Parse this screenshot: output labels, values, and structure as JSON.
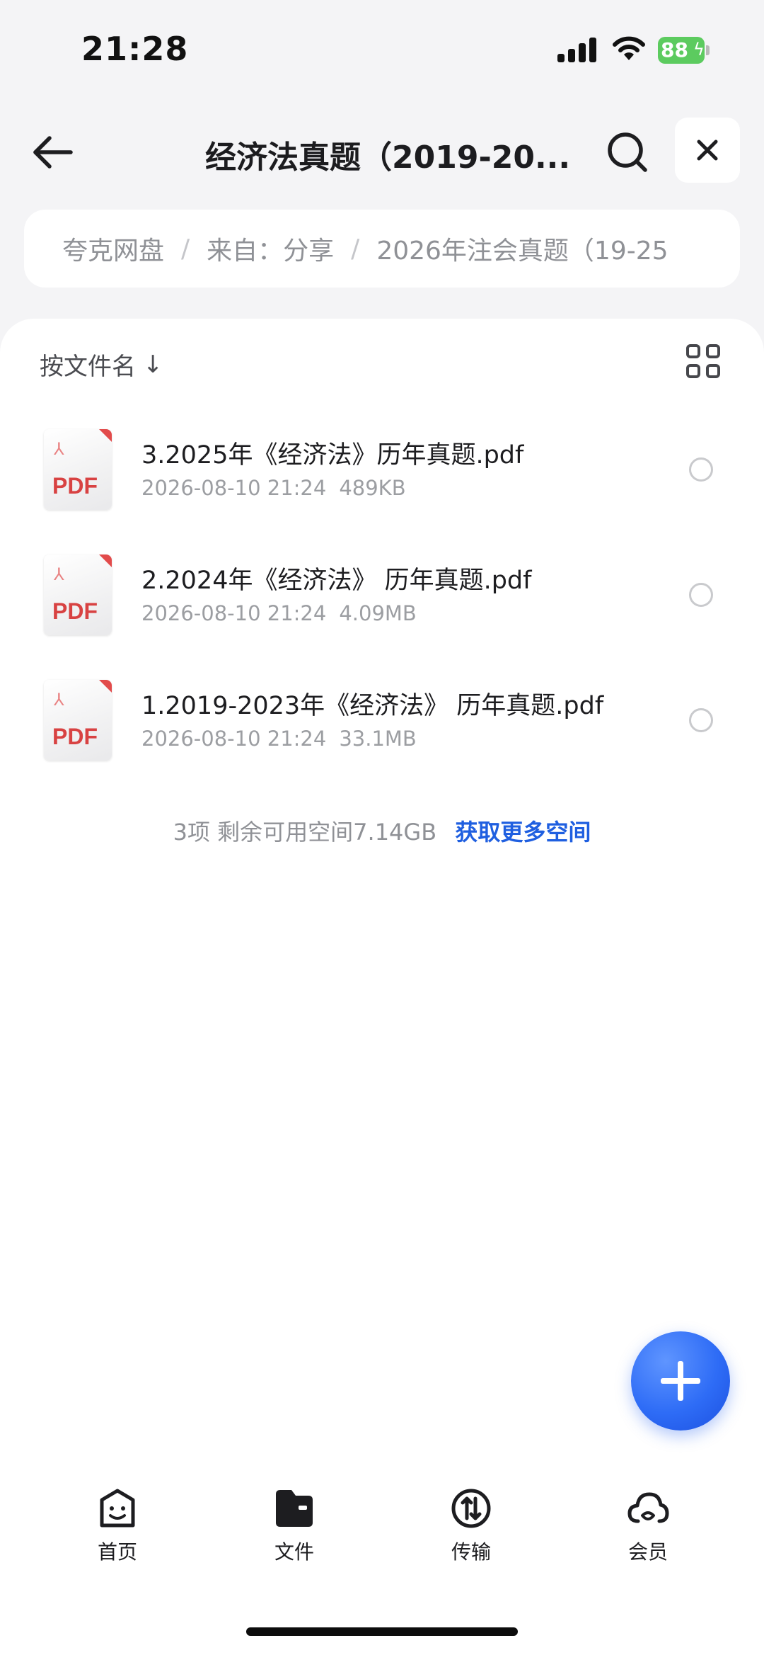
{
  "status_bar": {
    "time": "21:28",
    "battery_level": "88",
    "icons": [
      "signal-icon",
      "wifi-icon",
      "battery-icon"
    ]
  },
  "header": {
    "title": "经济法真题（2019-20...",
    "back_icon": "arrow-left-icon",
    "search_icon": "search-icon",
    "close_icon": "close-icon"
  },
  "breadcrumb": {
    "items": [
      "夸克网盘",
      "来自：分享",
      "2026年注会真题（19-25"
    ],
    "separator": "/"
  },
  "sort": {
    "label": "按文件名",
    "arrow": "↓",
    "view_icon": "grid-view-icon"
  },
  "files": [
    {
      "name": "3.2025年《经济法》历年真题.pdf",
      "date": "2026-08-10 21:24",
      "size": "489KB",
      "type_label": "PDF"
    },
    {
      "name": "2.2024年《经济法》 历年真题.pdf",
      "date": "2026-08-10 21:24",
      "size": "4.09MB",
      "type_label": "PDF"
    },
    {
      "name": "1.2019-2023年《经济法》 历年真题.pdf",
      "date": "2026-08-10 21:24",
      "size": "33.1MB",
      "type_label": "PDF"
    }
  ],
  "summary": {
    "text": "3项 剩余可用空间7.14GB",
    "link": "获取更多空间"
  },
  "fab": {
    "icon": "plus-icon"
  },
  "tabs": [
    {
      "label": "首页",
      "icon": "home-smile-icon"
    },
    {
      "label": "文件",
      "icon": "folder-icon"
    },
    {
      "label": "传输",
      "icon": "transfer-icon"
    },
    {
      "label": "会员",
      "icon": "cloud-icon"
    }
  ],
  "colors": {
    "accent": "#2e6cf6",
    "link": "#1f5fe0",
    "pdf_red": "#d84242",
    "battery_green": "#5ccb5f"
  }
}
